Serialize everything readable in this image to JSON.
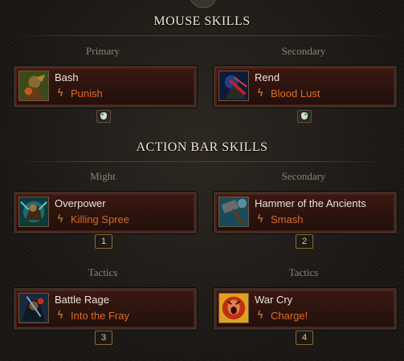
{
  "sections": {
    "mouse_title": "MOUSE SKILLS",
    "actionbar_title": "ACTION BAR SKILLS"
  },
  "mouse": {
    "left": {
      "label": "Primary",
      "skill": "Bash",
      "rune": "Punish"
    },
    "right": {
      "label": "Secondary",
      "skill": "Rend",
      "rune": "Blood Lust"
    }
  },
  "bar": [
    {
      "label": "Might",
      "skill": "Overpower",
      "rune": "Killing Spree",
      "key": "1"
    },
    {
      "label": "Secondary",
      "skill": "Hammer of the Ancients",
      "rune": "Smash",
      "key": "2"
    },
    {
      "label": "Tactics",
      "skill": "Battle Rage",
      "rune": "Into the Fray",
      "key": "3"
    },
    {
      "label": "Tactics",
      "skill": "War Cry",
      "rune": "Charge!",
      "key": "4"
    }
  ],
  "icons": {
    "bash": "bash-skill-icon",
    "rend": "rend-skill-icon",
    "overpower": "overpower-skill-icon",
    "hammer": "hammer-skill-icon",
    "battle_rage": "battle-rage-skill-icon",
    "war_cry": "war-cry-skill-icon",
    "rune": "rune-lightning-icon",
    "mouse": "mouse-icon"
  },
  "colors": {
    "rune_text": "#e26a1c",
    "skill_text": "#ece4d4",
    "section_text": "#efe6d6",
    "label_text": "#8a8276",
    "slot_border": "#5b1d10"
  }
}
